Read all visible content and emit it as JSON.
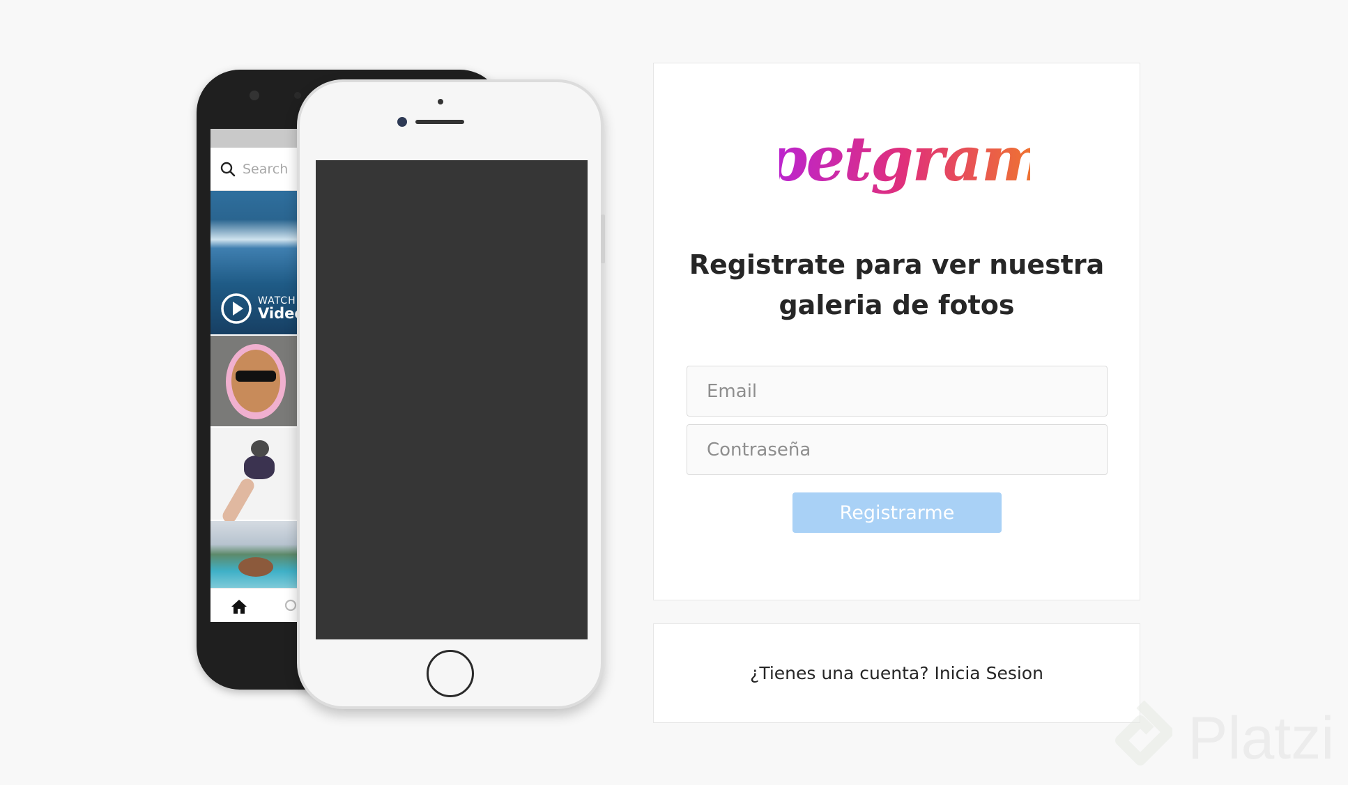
{
  "brand": {
    "name": "petgram",
    "gradient": [
      "#b823d6",
      "#e0307a",
      "#f07a2a"
    ]
  },
  "phone_preview": {
    "search_placeholder": "Search",
    "tile_overlay": {
      "line1": "WATCH",
      "line2": "Video"
    },
    "icons": [
      "search-icon",
      "play-icon",
      "home-icon"
    ]
  },
  "signup": {
    "heading_line1": "Registrate para ver nuestra",
    "heading_line2": "galeria de fotos",
    "email_placeholder": "Email",
    "password_placeholder": "Contraseña",
    "submit_label": "Registrarme",
    "submit_color": "#a9d1f6"
  },
  "login_prompt": {
    "text": "¿Tienes una cuenta? Inicia Sesion"
  },
  "watermark": {
    "text": "Platzi"
  }
}
